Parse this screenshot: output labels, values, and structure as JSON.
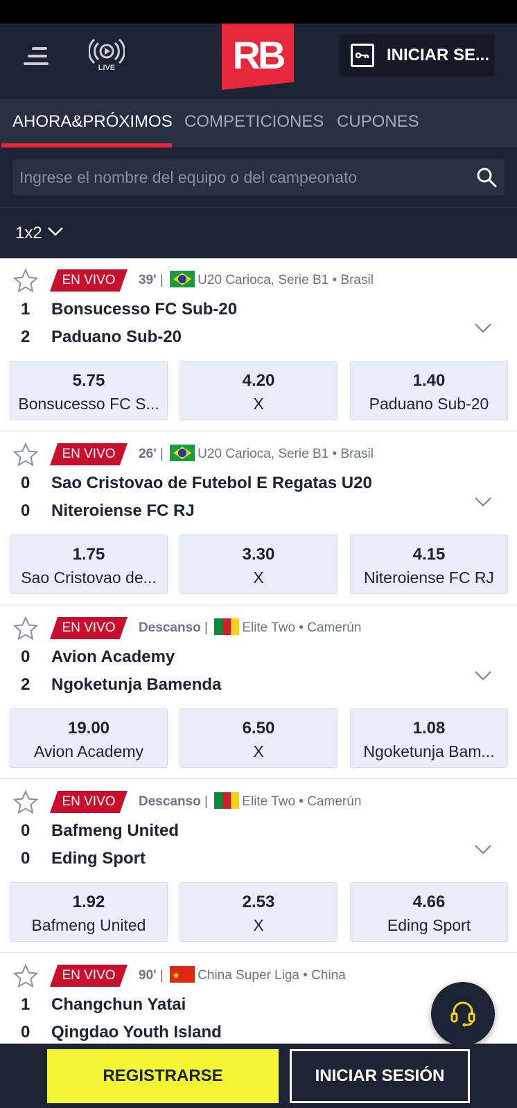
{
  "header": {
    "live_label": "LIVE",
    "logo_text": "RB",
    "login_label": "INICIAR SE..."
  },
  "tabs": [
    {
      "label": "AHORA&PRÓXIMOS",
      "active": true
    },
    {
      "label": "COMPETICIONES",
      "active": false
    },
    {
      "label": "CUPONES",
      "active": false
    }
  ],
  "search": {
    "placeholder": "Ingrese el nombre del equipo o del campeonato"
  },
  "market": {
    "label": "1x2"
  },
  "events": [
    {
      "badge": "EN VIVO",
      "time": "39'",
      "flag": "brazil-flag",
      "league": "U20 Carioca, Serie B1",
      "country": "Brasil",
      "home": {
        "score": "1",
        "name": "Bonsucesso FC Sub-20"
      },
      "away": {
        "score": "2",
        "name": "Paduano Sub-20"
      },
      "odds": [
        {
          "value": "5.75",
          "label": "Bonsucesso FC S..."
        },
        {
          "value": "4.20",
          "label": "X"
        },
        {
          "value": "1.40",
          "label": "Paduano Sub-20"
        }
      ]
    },
    {
      "badge": "EN VIVO",
      "time": "26'",
      "flag": "brazil-flag",
      "league": "U20 Carioca, Serie B1",
      "country": "Brasil",
      "home": {
        "score": "0",
        "name": "Sao Cristovao de Futebol E Regatas U20"
      },
      "away": {
        "score": "0",
        "name": "Niteroiense FC RJ"
      },
      "odds": [
        {
          "value": "1.75",
          "label": "Sao Cristovao de..."
        },
        {
          "value": "3.30",
          "label": "X"
        },
        {
          "value": "4.15",
          "label": "Niteroiense FC RJ"
        }
      ]
    },
    {
      "badge": "EN VIVO",
      "time": "Descanso",
      "flag": "cameroon-flag",
      "league": "Elite Two",
      "country": "Camerún",
      "home": {
        "score": "0",
        "name": "Avion Academy"
      },
      "away": {
        "score": "2",
        "name": "Ngoketunja Bamenda"
      },
      "odds": [
        {
          "value": "19.00",
          "label": "Avion Academy"
        },
        {
          "value": "6.50",
          "label": "X"
        },
        {
          "value": "1.08",
          "label": "Ngoketunja Bam..."
        }
      ]
    },
    {
      "badge": "EN VIVO",
      "time": "Descanso",
      "flag": "cameroon-flag",
      "league": "Elite Two",
      "country": "Camerún",
      "home": {
        "score": "0",
        "name": "Bafmeng United"
      },
      "away": {
        "score": "0",
        "name": "Eding Sport"
      },
      "odds": [
        {
          "value": "1.92",
          "label": "Bafmeng United"
        },
        {
          "value": "2.53",
          "label": "X"
        },
        {
          "value": "4.66",
          "label": "Eding Sport"
        }
      ]
    },
    {
      "badge": "EN VIVO",
      "time": "90'",
      "flag": "china-flag",
      "league": "China Super Liga",
      "country": "China",
      "home": {
        "score": "1",
        "name": "Changchun Yatai"
      },
      "away": {
        "score": "0",
        "name": "Qingdao Youth Island"
      },
      "odds": []
    }
  ],
  "footer": {
    "register_label": "REGISTRARSE",
    "login_label": "INICIAR SESIÓN"
  },
  "colors": {
    "brand_red": "#e8273d",
    "navy": "#1c2333",
    "register_yellow": "#f2f531",
    "odds_bg": "#e8eef7"
  }
}
